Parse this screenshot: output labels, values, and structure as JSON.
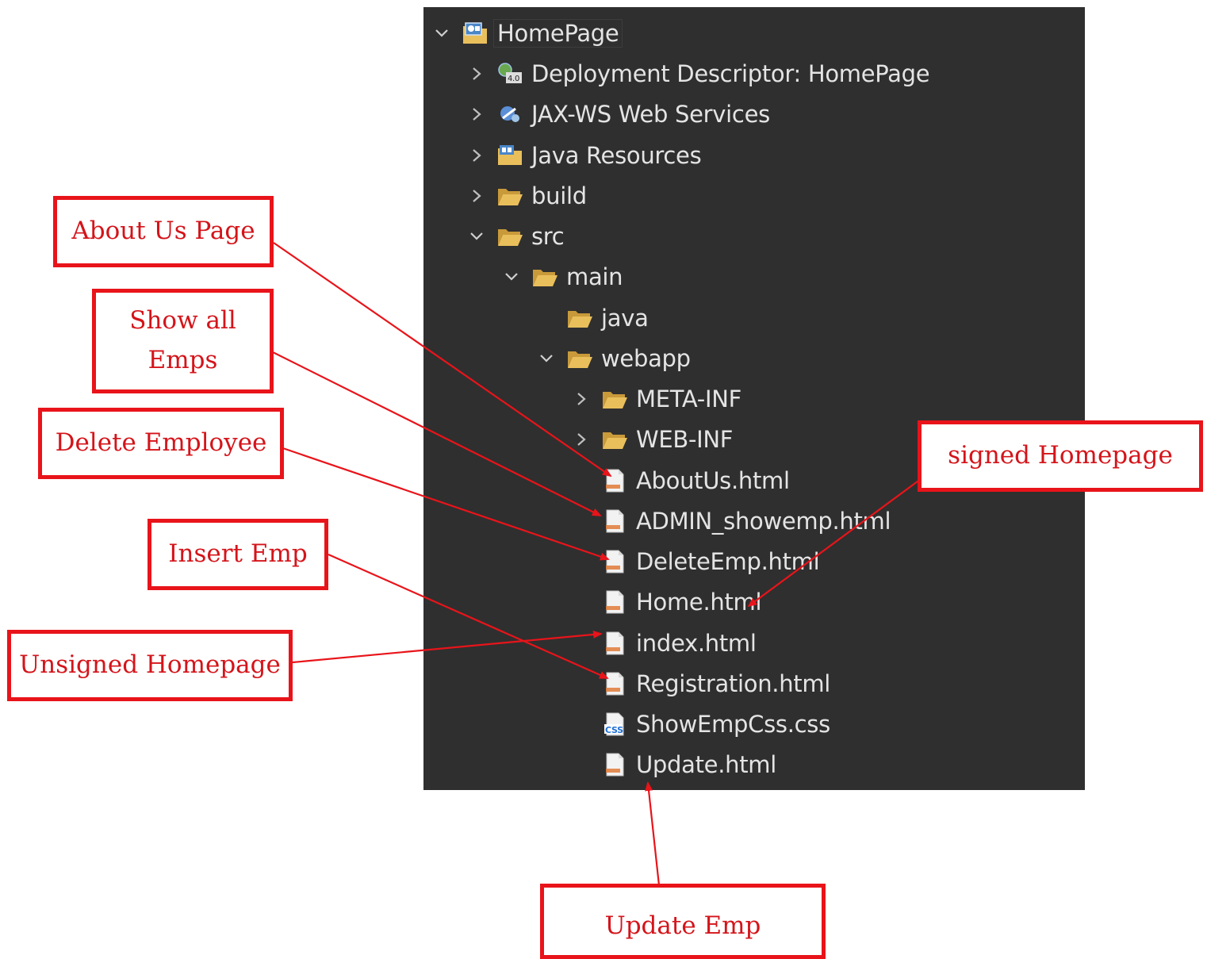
{
  "tree": {
    "root": {
      "label": "HomePage",
      "expanded": true,
      "icon": "web-project-icon"
    },
    "items": [
      {
        "label": "Deployment Descriptor: HomePage",
        "icon": "deployment-descriptor-icon",
        "expander": "collapsed"
      },
      {
        "label": "JAX-WS Web Services",
        "icon": "web-services-icon",
        "expander": "collapsed"
      },
      {
        "label": "Java Resources",
        "icon": "java-resources-icon",
        "expander": "collapsed"
      },
      {
        "label": "build",
        "icon": "folder-icon",
        "expander": "collapsed"
      },
      {
        "label": "src",
        "icon": "folder-icon",
        "expander": "expanded"
      },
      {
        "label": "main",
        "icon": "folder-icon",
        "expander": "expanded"
      },
      {
        "label": "java",
        "icon": "folder-icon",
        "expander": "none"
      },
      {
        "label": "webapp",
        "icon": "folder-icon",
        "expander": "expanded"
      },
      {
        "label": "META-INF",
        "icon": "folder-icon",
        "expander": "collapsed"
      },
      {
        "label": "WEB-INF",
        "icon": "folder-icon",
        "expander": "collapsed"
      },
      {
        "label": "AboutUs.html",
        "icon": "html-file-icon",
        "expander": "none"
      },
      {
        "label": "ADMIN_showemp.html",
        "icon": "html-file-icon",
        "expander": "none"
      },
      {
        "label": "DeleteEmp.html",
        "icon": "html-file-icon",
        "expander": "none"
      },
      {
        "label": "Home.html",
        "icon": "html-file-icon",
        "expander": "none"
      },
      {
        "label": "index.html",
        "icon": "html-file-icon",
        "expander": "none"
      },
      {
        "label": "Registration.html",
        "icon": "html-file-icon",
        "expander": "none"
      },
      {
        "label": "ShowEmpCss.css",
        "icon": "css-file-icon",
        "expander": "none"
      },
      {
        "label": "Update.html",
        "icon": "html-file-icon",
        "expander": "none"
      }
    ]
  },
  "callouts": {
    "about_us": "About Us Page",
    "show_all": "Show all Emps",
    "delete": "Delete Employee",
    "insert": "Insert Emp",
    "unsigned": "Unsigned Homepage",
    "signed": "signed Homepage",
    "update": "Update Emp"
  },
  "colors": {
    "panel_bg": "#2f2f2f",
    "tree_text": "#e4e4e4",
    "callout_red": "#e8141a",
    "folder": "#e9bf5c"
  }
}
